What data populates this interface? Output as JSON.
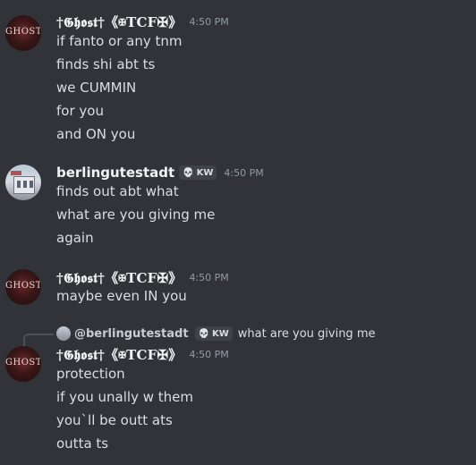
{
  "messages": [
    {
      "author": "†𝕲𝖍𝖔𝖘𝖙†《✠TCF✠》",
      "timestamp": "4:50 PM",
      "avatar_text": "GHOST",
      "lines": [
        "if fanto or any tnm",
        "finds shi abt ts",
        "we CUMMIN",
        "for you",
        "and ON you"
      ]
    },
    {
      "author": "berlingutestadt",
      "tag": "KW",
      "timestamp": "4:50 PM",
      "lines": [
        "finds out abt what",
        "what are you giving me",
        "again"
      ]
    },
    {
      "author": "†𝕲𝖍𝖔𝖘𝖙†《✠TCF✠》",
      "timestamp": "4:50 PM",
      "avatar_text": "GHOST",
      "lines": [
        "maybe even IN you"
      ]
    },
    {
      "reply": {
        "author": "@berlingutestadt",
        "tag": "KW",
        "content": "what are you giving me"
      },
      "author": "†𝕲𝖍𝖔𝖘𝖙†《✠TCF✠》",
      "timestamp": "4:50 PM",
      "avatar_text": "GHOST",
      "lines": [
        "protection",
        "if you unally w them",
        "you`ll be outt ats",
        "outta ts"
      ]
    }
  ],
  "colors": {
    "background": "#313338",
    "text": "#dbdee1",
    "timestamp": "#949ba4",
    "tag_bg": "#404249"
  },
  "icons": {
    "tag_icon": "skull-icon"
  }
}
